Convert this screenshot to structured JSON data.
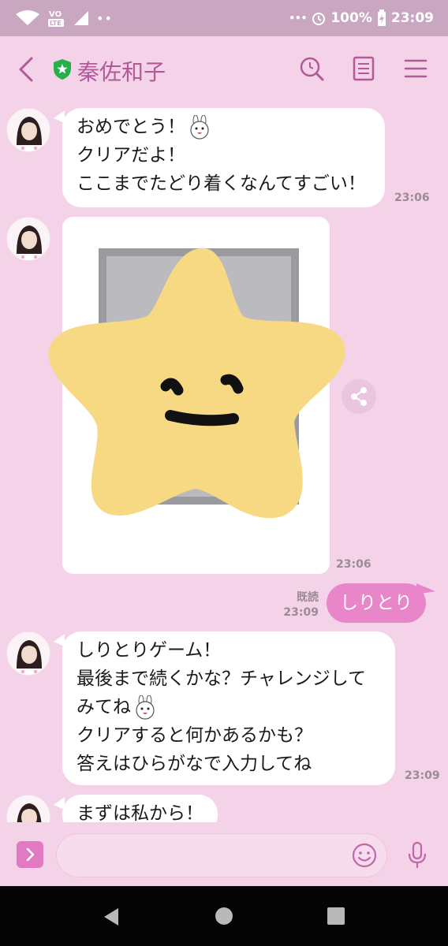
{
  "status_bar": {
    "network": "VoLTE",
    "battery": "100%",
    "time": "23:09",
    "more": "•••",
    "app_dots": "••"
  },
  "header": {
    "title": "秦佐和子",
    "icons": [
      "back-icon",
      "shield-star-icon",
      "search-icon",
      "notes-icon",
      "menu-icon"
    ],
    "accent_color": "#b05a98"
  },
  "messages": [
    {
      "sender": "other",
      "lines": [
        "おめでとう！",
        "クリアだよ！",
        "ここまでたどり着くなんてすごい！"
      ],
      "time": "23:06"
    },
    {
      "sender": "other",
      "type": "image",
      "time": "23:06"
    },
    {
      "sender": "me",
      "text": "しりとり",
      "read_label": "既読",
      "time": "23:09"
    },
    {
      "sender": "other",
      "lines": [
        "しりとりゲーム！",
        "最後まで続くかな？チャレンジして",
        "みてね",
        "クリアすると何かあるかも？",
        "答えはひらがなで入力してね"
      ],
      "time": "23:09"
    },
    {
      "sender": "other",
      "lines": [
        "まずは私から！"
      ]
    }
  ],
  "input_bar": {
    "value": "",
    "placeholder": ""
  },
  "colors": {
    "background": "#f4d3e9",
    "my_bubble": "#e985c9",
    "status_bar": "#c9a7c0"
  }
}
